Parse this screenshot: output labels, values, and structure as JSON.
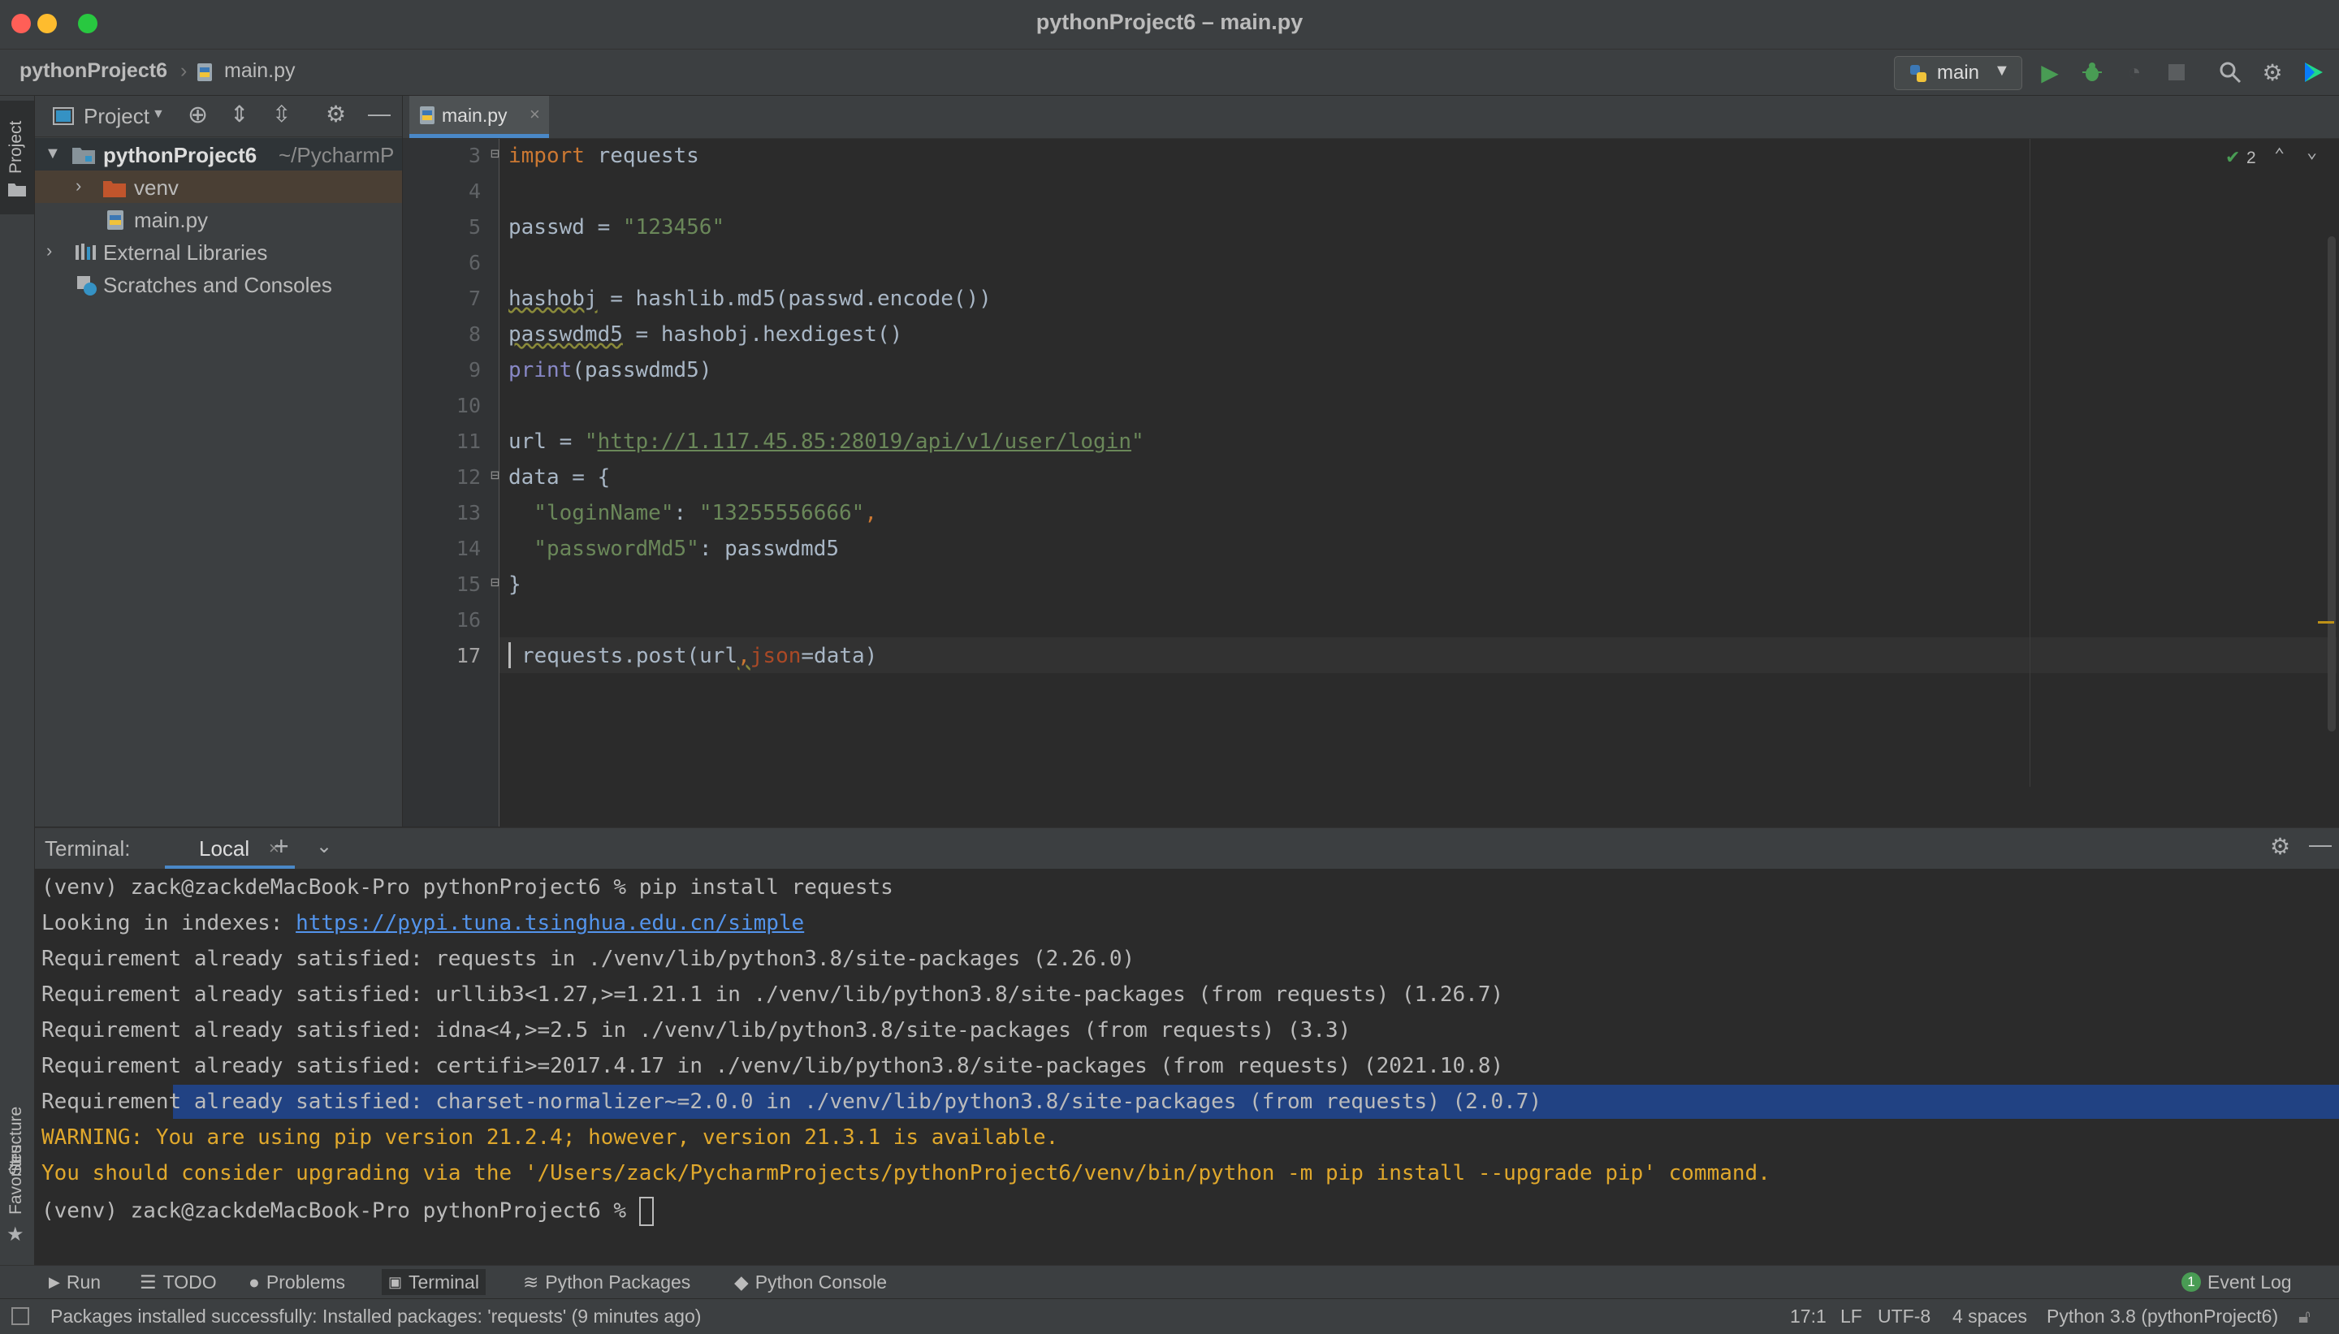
{
  "window": {
    "title": "pythonProject6 – main.py"
  },
  "navbar": {
    "project": "pythonProject6",
    "file": "main.py",
    "run_config": "main"
  },
  "side_tabs": {
    "project": "Project",
    "structure": "Structure",
    "favorites": "Favorites"
  },
  "project_panel": {
    "title": "Project",
    "tree": [
      {
        "label": "pythonProject6",
        "suffix": "~/PycharmP"
      },
      {
        "label": "venv"
      },
      {
        "label": "main.py"
      },
      {
        "label": "External Libraries"
      },
      {
        "label": "Scratches and Consoles"
      }
    ]
  },
  "editor": {
    "tab": "main.py",
    "inspection_count": "2",
    "line_numbers": [
      "3",
      "4",
      "5",
      "6",
      "7",
      "8",
      "9",
      "10",
      "11",
      "12",
      "13",
      "14",
      "15",
      "16",
      "17"
    ],
    "code": {
      "l3_kw": "import",
      "l3_rest": " requests",
      "l5_var": "passwd = ",
      "l5_str": "\"123456\"",
      "l7_var": "hashobj",
      "l7_rest": " = hashlib.md5(passwd.encode())",
      "l8_var": "passwdmd5",
      "l8_rest": " = hashobj.hexdigest()",
      "l9_fn": "print",
      "l9_rest": "(passwdmd5)",
      "l11_var": "url = ",
      "l11_q1": "\"",
      "l11_url": "http://1.117.45.85:28019/api/v1/user/login",
      "l11_q2": "\"",
      "l12": "data = {",
      "l13_key": "  \"loginName\"",
      "l13_colon": ": ",
      "l13_val": "\"13255556666\"",
      "l13_comma": ",",
      "l14_key": "  \"passwordMd5\"",
      "l14_rest": ": passwdmd5",
      "l15": "}",
      "l17_a": "requests.post(url",
      "l17_comma": ",",
      "l17_param": "json",
      "l17_b": "=data)"
    }
  },
  "terminal": {
    "label": "Terminal:",
    "tab": "Local",
    "lines": [
      "(venv) zack@zackdeMacBook-Pro pythonProject6 % pip install requests",
      "Looking in indexes: ",
      "Requirement already satisfied: requests in ./venv/lib/python3.8/site-packages (2.26.0)",
      "Requirement already satisfied: urllib3<1.27,>=1.21.1 in ./venv/lib/python3.8/site-packages (from requests) (1.26.7)",
      "Requirement already satisfied: idna<4,>=2.5 in ./venv/lib/python3.8/site-packages (from requests) (3.3)",
      "Requirement already satisfied: certifi>=2017.4.17 in ./venv/lib/python3.8/site-packages (from requests) (2021.10.8)",
      "Requirement already satisfied: charset-normalizer~=2.0.0 in ./venv/lib/python3.8/site-packages (from requests) (2.0.7)",
      "WARNING: You are using pip version 21.2.4; however, version 21.3.1 is available.",
      "You should consider upgrading via the '/Users/zack/PycharmProjects/pythonProject6/venv/bin/python -m pip install --upgrade pip' command.",
      "(venv) zack@zackdeMacBook-Pro pythonProject6 % "
    ],
    "index_url": "https://pypi.tuna.tsinghua.edu.cn/simple"
  },
  "bottom_tools": {
    "run": "Run",
    "todo": "TODO",
    "problems": "Problems",
    "terminal": "Terminal",
    "python_packages": "Python Packages",
    "python_console": "Python Console",
    "event_log": "Event Log",
    "event_count": "1"
  },
  "status": {
    "message": "Packages installed successfully: Installed packages: 'requests' (9 minutes ago)",
    "position": "17:1",
    "line_sep": "LF",
    "encoding": "UTF-8",
    "indent": "4 spaces",
    "interpreter": "Python 3.8 (pythonProject6)"
  },
  "colors": {
    "accent": "#4a88c7",
    "selection": "#214283",
    "run_green": "#499c54"
  }
}
